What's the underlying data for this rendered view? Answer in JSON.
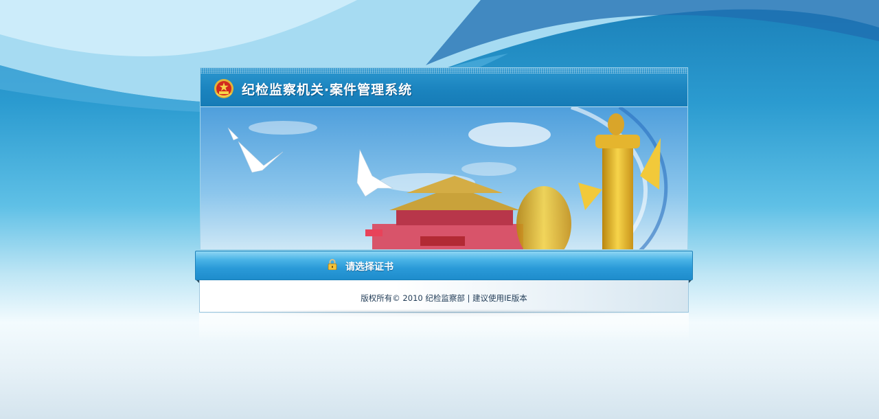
{
  "header": {
    "title": "纪检监察机关·案件管理系统",
    "emblem_icon": "national-emblem-icon"
  },
  "banner": {
    "description_icons": [
      "dove-icon",
      "tiananmen-icon",
      "huabiao-pillar-icon"
    ]
  },
  "actions": {
    "select_certificate_label": "请选择证书",
    "lock_icon": "lock-icon"
  },
  "footer": {
    "copyright": "版权所有© 2010 纪检监察部 | 建议使用IE版本"
  },
  "colors": {
    "header_blue": "#1b84bf",
    "action_bar_blue": "#2a9ad8",
    "background_top": "#1a7fb8",
    "text_dark": "#1f3a55"
  }
}
